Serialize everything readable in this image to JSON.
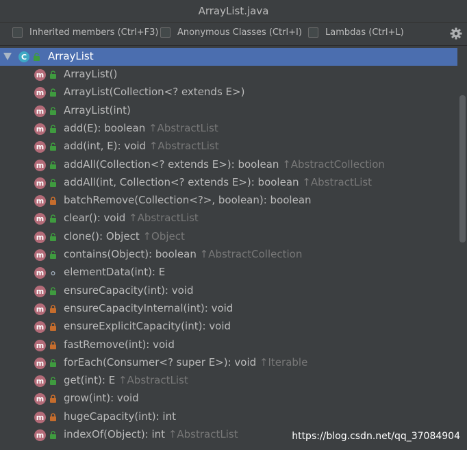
{
  "window": {
    "title": "ArrayList.java"
  },
  "toolbar": {
    "inherited_label": "Inherited members (Ctrl+F3)",
    "anonymous_label": "Anonymous Classes (Ctrl+I)",
    "lambdas_label": "Lambdas (Ctrl+L)"
  },
  "colors": {
    "root_selected_bg": "#4b6eaf",
    "method_badge": "#b36b78",
    "class_badge": "#3ea8c4",
    "public_lock": "#3f9b3f",
    "private_lock": "#c66d2d",
    "inherited_text": "#787878"
  },
  "tree": {
    "root": {
      "icon": "C",
      "label": "ArrayList"
    },
    "items": [
      {
        "badge": "m",
        "visibility": "public",
        "signature": "ArrayList()",
        "inherited": ""
      },
      {
        "badge": "m",
        "visibility": "public",
        "signature": "ArrayList(Collection<? extends E>)",
        "inherited": ""
      },
      {
        "badge": "m",
        "visibility": "public",
        "signature": "ArrayList(int)",
        "inherited": ""
      },
      {
        "badge": "m",
        "visibility": "public",
        "signature": "add(E): boolean",
        "inherited": "↑AbstractList"
      },
      {
        "badge": "m",
        "visibility": "public",
        "signature": "add(int, E): void",
        "inherited": "↑AbstractList"
      },
      {
        "badge": "m",
        "visibility": "public",
        "signature": "addAll(Collection<? extends E>): boolean",
        "inherited": "↑AbstractCollection"
      },
      {
        "badge": "m",
        "visibility": "public",
        "signature": "addAll(int, Collection<? extends E>): boolean",
        "inherited": "↑AbstractList"
      },
      {
        "badge": "m",
        "visibility": "private",
        "signature": "batchRemove(Collection<?>, boolean): boolean",
        "inherited": ""
      },
      {
        "badge": "m",
        "visibility": "public",
        "signature": "clear(): void",
        "inherited": "↑AbstractList"
      },
      {
        "badge": "m",
        "visibility": "public",
        "signature": "clone(): Object",
        "inherited": "↑Object"
      },
      {
        "badge": "m",
        "visibility": "public",
        "signature": "contains(Object): boolean",
        "inherited": "↑AbstractCollection"
      },
      {
        "badge": "m",
        "visibility": "package",
        "signature": "elementData(int): E",
        "inherited": ""
      },
      {
        "badge": "m",
        "visibility": "public",
        "signature": "ensureCapacity(int): void",
        "inherited": ""
      },
      {
        "badge": "m",
        "visibility": "private",
        "signature": "ensureCapacityInternal(int): void",
        "inherited": ""
      },
      {
        "badge": "m",
        "visibility": "private",
        "signature": "ensureExplicitCapacity(int): void",
        "inherited": ""
      },
      {
        "badge": "m",
        "visibility": "private",
        "signature": "fastRemove(int): void",
        "inherited": ""
      },
      {
        "badge": "m",
        "visibility": "public",
        "signature": "forEach(Consumer<? super E>): void",
        "inherited": "↑Iterable"
      },
      {
        "badge": "m",
        "visibility": "public",
        "signature": "get(int): E",
        "inherited": "↑AbstractList"
      },
      {
        "badge": "m",
        "visibility": "private",
        "signature": "grow(int): void",
        "inherited": ""
      },
      {
        "badge": "m",
        "visibility": "private",
        "signature": "hugeCapacity(int): int",
        "inherited": ""
      },
      {
        "badge": "m",
        "visibility": "public",
        "signature": "indexOf(Object): int",
        "inherited": "↑AbstractList"
      }
    ]
  },
  "watermark": "https://blog.csdn.net/qq_37084904"
}
